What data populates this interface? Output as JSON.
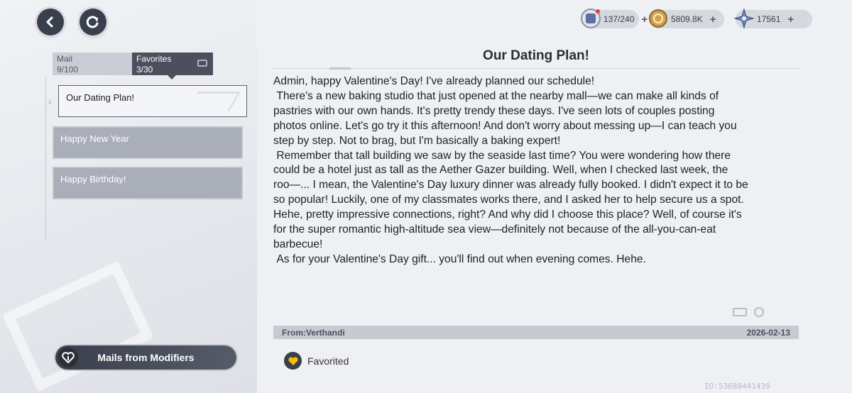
{
  "header": {
    "resources": [
      {
        "icon": "stamina-icon",
        "value": "137/240",
        "plus": "+"
      },
      {
        "icon": "gold-coin-icon",
        "value": "5809.8K",
        "plus": "+"
      },
      {
        "icon": "crystal-star-icon",
        "value": "17561",
        "plus": "+"
      }
    ]
  },
  "sidebar": {
    "tabs": [
      {
        "label": "Mail",
        "count": "9/100"
      },
      {
        "label": "Favorites",
        "count": "3/30"
      }
    ],
    "items": [
      {
        "label": "Our Dating Plan!"
      },
      {
        "label": "Happy New Year"
      },
      {
        "label": "Happy Birthday!"
      }
    ],
    "footer_button": "Mails from Modifiers"
  },
  "mail": {
    "title": "Our Dating Plan!",
    "body": "Admin, happy Valentine's Day! I've already planned our schedule!\n There's a new baking studio that just opened at the nearby mall—we can make all kinds of\npastries with our own hands. It's pretty trendy these days. I've seen lots of couples posting\nphotos online. Let's go try it this afternoon! And don't worry about messing up—I can teach you\nstep by step. Not to brag, but I'm basically a baking expert!\n Remember that tall building we saw by the seaside last time? You were wondering how there\ncould be a hotel just as tall as the Aether Gazer building. Well, when I checked last week, the\nroo—... I mean, the Valentine's Day luxury dinner was already fully booked. I didn't expect it to be\nso popular! Luckily, one of my classmates works there, and I asked her to help secure us a spot.\nHehe, pretty impressive connections, right? And why did I choose this place? Well, of course it's\nfor the super romantic high-altitude sea view—definitely not because of the all-you-can-eat\nbarbecue!\n As for your Valentine's Day gift... you'll find out when evening comes. Hehe.",
    "from": "From:Verthandi",
    "date": "2026-02-13",
    "favorited_label": "Favorited"
  },
  "footer": {
    "id_text": "ID:53688441439"
  },
  "colors": {
    "accent_dark": "#3a3f4c",
    "heart_gold": "#f2c000",
    "alert_red": "#e23b3b"
  }
}
